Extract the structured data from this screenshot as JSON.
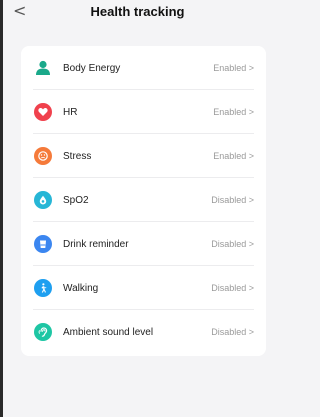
{
  "header": {
    "back_glyph": "<",
    "title": "Health tracking"
  },
  "items": [
    {
      "label": "Body Energy",
      "status": "Enabled >",
      "icon": "body-energy-icon",
      "color": "#1aa98a"
    },
    {
      "label": "HR",
      "status": "Enabled >",
      "icon": "heart-icon",
      "color": "#f0414d"
    },
    {
      "label": "Stress",
      "status": "Enabled >",
      "icon": "stress-face-icon",
      "color": "#f57a3a"
    },
    {
      "label": "SpO2",
      "status": "Disabled >",
      "icon": "oxygen-drop-icon",
      "color": "#27b6d6"
    },
    {
      "label": "Drink reminder",
      "status": "Disabled >",
      "icon": "cup-icon",
      "color": "#3b86f0"
    },
    {
      "label": "Walking",
      "status": "Disabled >",
      "icon": "walking-icon",
      "color": "#1e9ff0"
    },
    {
      "label": "Ambient sound level",
      "status": "Disabled >",
      "icon": "ear-icon",
      "color": "#1ec6a4"
    }
  ]
}
